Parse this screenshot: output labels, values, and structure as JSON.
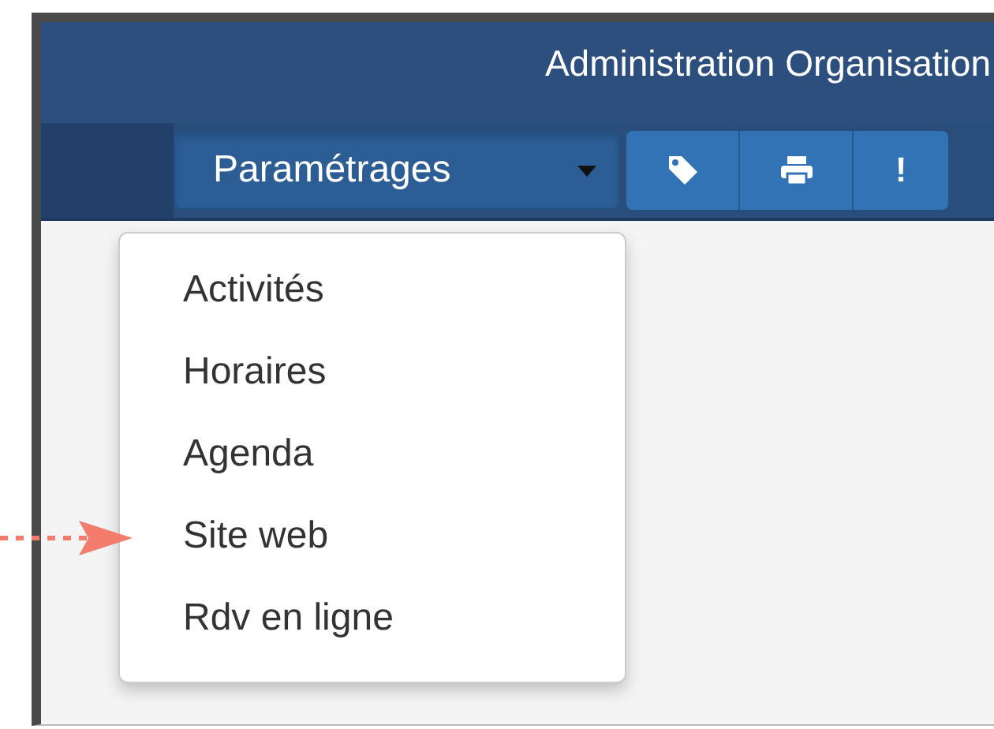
{
  "header": {
    "title": "Administration Organisation"
  },
  "toolbar": {
    "dropdown": {
      "label": "Paramétrages",
      "expanded": true
    },
    "buttons": [
      {
        "kind": "tag"
      },
      {
        "kind": "print"
      },
      {
        "kind": "text",
        "label": "!"
      }
    ]
  },
  "menu": {
    "items": [
      {
        "label": "Activités"
      },
      {
        "label": "Horaires"
      },
      {
        "label": "Agenda"
      },
      {
        "label": "Site web"
      },
      {
        "label": "Rdv en ligne"
      }
    ]
  }
}
